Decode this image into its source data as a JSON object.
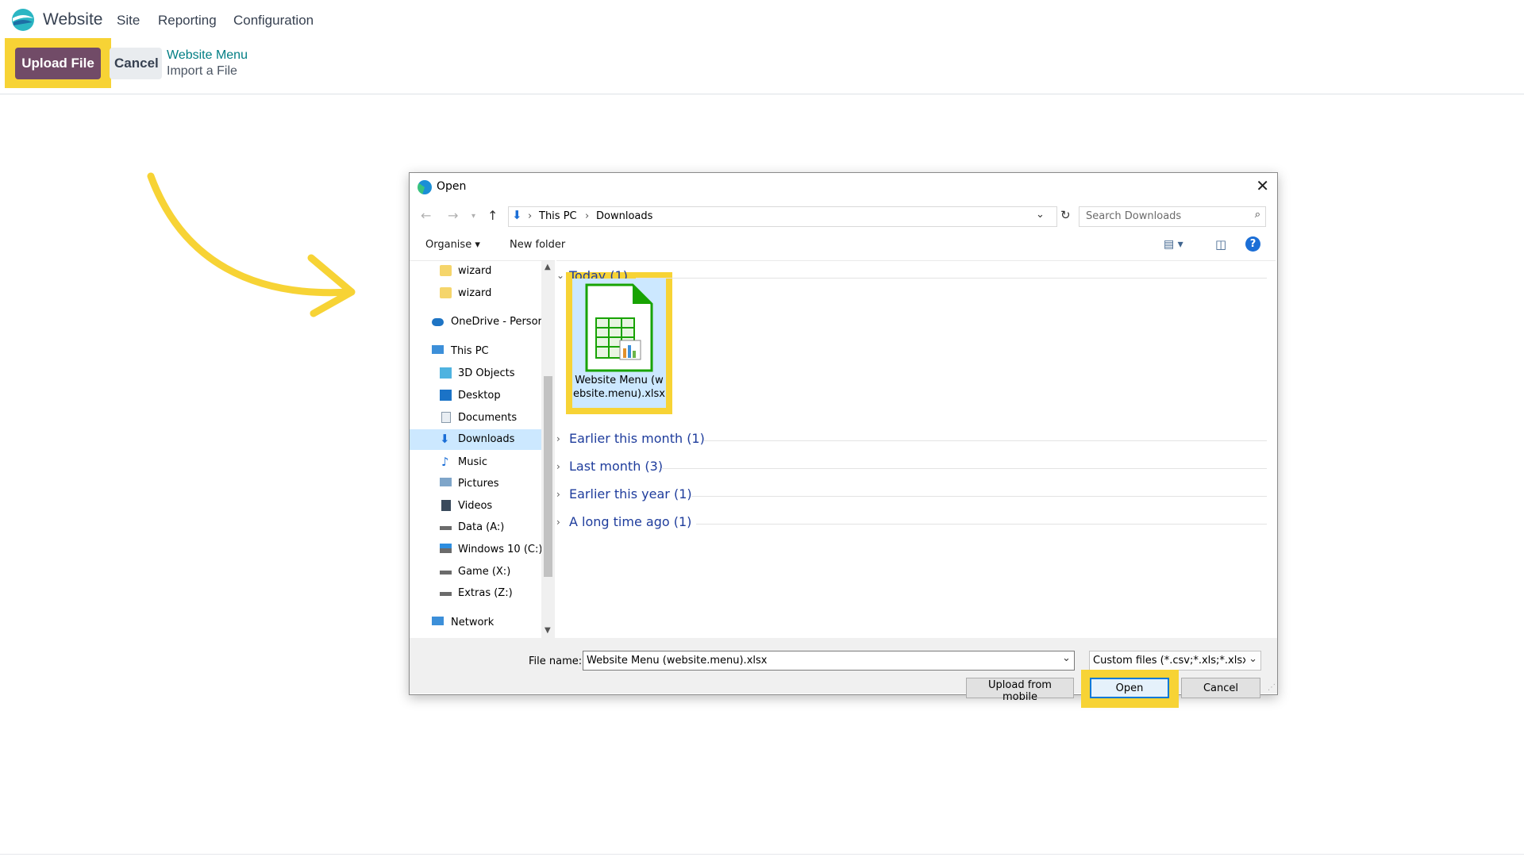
{
  "app": {
    "brand": "Website",
    "menu": [
      "Site",
      "Reporting",
      "Configuration"
    ]
  },
  "control_panel": {
    "upload_label": "Upload File",
    "cancel_label": "Cancel",
    "breadcrumb_parent": "Website Menu",
    "breadcrumb_current": "Import a File"
  },
  "dialog": {
    "title": "Open",
    "path": [
      "This PC",
      "Downloads"
    ],
    "search_placeholder": "Search Downloads",
    "toolbar": {
      "organise": "Organise",
      "new_folder": "New folder"
    },
    "nav_tree": [
      {
        "label": "wizard",
        "icon": "folder-icon"
      },
      {
        "label": "wizard",
        "icon": "folder-icon"
      },
      {
        "label": "OneDrive - Persor",
        "icon": "cloud-icon"
      },
      {
        "label": "This PC",
        "icon": "computer-icon"
      },
      {
        "label": "3D Objects",
        "icon": "cube-icon"
      },
      {
        "label": "Desktop",
        "icon": "desktop-icon"
      },
      {
        "label": "Documents",
        "icon": "document-icon"
      },
      {
        "label": "Downloads",
        "icon": "download-icon",
        "selected": true
      },
      {
        "label": "Music",
        "icon": "music-icon"
      },
      {
        "label": "Pictures",
        "icon": "pictures-icon"
      },
      {
        "label": "Videos",
        "icon": "videos-icon"
      },
      {
        "label": "Data (A:)",
        "icon": "drive-icon"
      },
      {
        "label": "Windows 10 (C:)",
        "icon": "system-drive-icon"
      },
      {
        "label": "Game (X:)",
        "icon": "drive-icon"
      },
      {
        "label": "Extras (Z:)",
        "icon": "drive-icon"
      },
      {
        "label": "Network",
        "icon": "network-icon"
      }
    ],
    "groups": {
      "today": "Today (1)",
      "earlier_this_month": "Earlier this month (1)",
      "last_month": "Last month (3)",
      "earlier_this_year": "Earlier this year (1)",
      "long_time_ago": "A long time ago (1)"
    },
    "file": {
      "name": "Website Menu (website.menu).xlsx"
    },
    "file_name_label": "File name:",
    "file_name_value": "Website Menu (website.menu).xlsx",
    "filter": "Custom files (*.csv;*.xls;*.xlsx;*.",
    "upload_mobile": "Upload from mobile",
    "open": "Open",
    "cancel": "Cancel"
  },
  "colors": {
    "brand_primary": "#714b67",
    "highlight": "#f7d335",
    "link": "#017e84",
    "selection": "#cce8ff"
  }
}
